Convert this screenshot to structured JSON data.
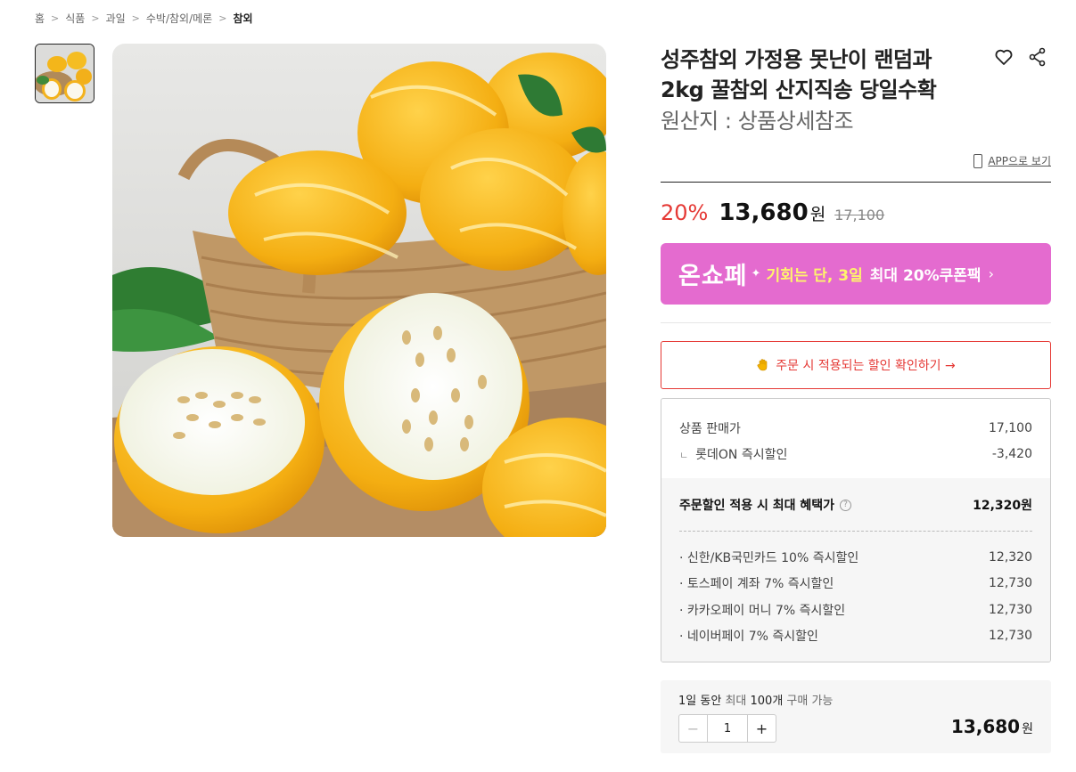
{
  "breadcrumb": [
    "홈",
    "식품",
    "과일",
    "수박/참외/메론",
    "참외"
  ],
  "product": {
    "title": "성주참외 가정용 못난이 랜덤과 2kg 꿀참외 산지직송 당일수확",
    "origin": "원산지 : 상품상세참조",
    "app_link": "APP으로 보기"
  },
  "price": {
    "discount_rate": "20%",
    "sale_price": "13,680",
    "currency": "원",
    "original_price": "17,100"
  },
  "banner": {
    "logo": "온쇼페",
    "chance_text": "기회는 단, 3일",
    "max_text": "최대 20%쿠폰팩",
    "chevron": "›",
    "bg_color": "#e46bcf",
    "highlight_color": "#fff46c"
  },
  "discount_check": {
    "label": "주문 시 적용되는 할인 확인하기 →"
  },
  "breakdown": {
    "sale_price_label": "상품 판매가",
    "sale_price_value": "17,100",
    "instant_label": "롯데ON 즉시할인",
    "instant_value": "-3,420",
    "sub_mark": "ㄴ",
    "total_label": "주문할인 적용 시 최대 혜택가",
    "total_help": "?",
    "total_value": "12,320원",
    "cards": [
      {
        "label": "· 신한/KB국민카드 10% 즉시할인",
        "value": "12,320"
      },
      {
        "label": "· 토스페이 계좌 7% 즉시할인",
        "value": "12,730"
      },
      {
        "label": "· 카카오페이 머니 7% 즉시할인",
        "value": "12,730"
      },
      {
        "label": "· 네이버페이 7% 즉시할인",
        "value": "12,730"
      }
    ]
  },
  "quantity": {
    "note_prefix": "1일 동안",
    "note_mid": "최대",
    "note_count": "100개",
    "note_suffix": "구매 가능",
    "minus": "−",
    "plus": "+",
    "value": "1",
    "total": "13,680",
    "unit": "원"
  },
  "icons": {
    "wish": "heart-icon",
    "share": "share-icon",
    "phone": "phone-icon",
    "hand": "hand-icon"
  },
  "colors": {
    "accent_red": "#e53935"
  }
}
